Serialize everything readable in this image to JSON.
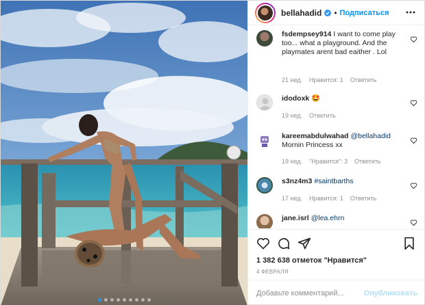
{
  "header": {
    "username": "bellahadid",
    "separator": "•",
    "follow_label": "Подписаться"
  },
  "comments": [
    {
      "user": "fsdempsey914",
      "text": "I want to come play too... what a playground. And the playmates arent bad eaither . Lol",
      "time": "21 нед.",
      "likes": "Нравится: 1",
      "reply": "Ответить"
    },
    {
      "user": "idodoxk",
      "text": "🤩",
      "time": "19 нед.",
      "reply": "Ответить"
    },
    {
      "user": "kareemabdulwahad",
      "mention": "@bellahadid",
      "text": "Mornin Princess xx",
      "time": "19 нед.",
      "likes": "\"Нравится\": 3",
      "reply": "Ответить"
    },
    {
      "user": "s3nz4m3",
      "mention": "#saintbarths",
      "time": "17 нед.",
      "likes": "Нравится: 1",
      "reply": "Ответить"
    },
    {
      "user": "jane.isrl",
      "mention": "@lea.ehrn"
    }
  ],
  "actions": {
    "likes_text": "1 382 638 отметок \"Нравится\"",
    "date": "4 февраля"
  },
  "add_comment": {
    "placeholder": "Добавьте комментарий...",
    "publish_label": "Опубликовать"
  },
  "carousel": {
    "count": 9,
    "active": 0
  },
  "colors": {
    "accent": "#0095f6",
    "verified": "#3897f0",
    "muted": "#8e8e8e"
  },
  "icons": [
    "more-icon",
    "verified-icon",
    "heart-icon",
    "comment-icon",
    "share-icon",
    "bookmark-icon"
  ]
}
